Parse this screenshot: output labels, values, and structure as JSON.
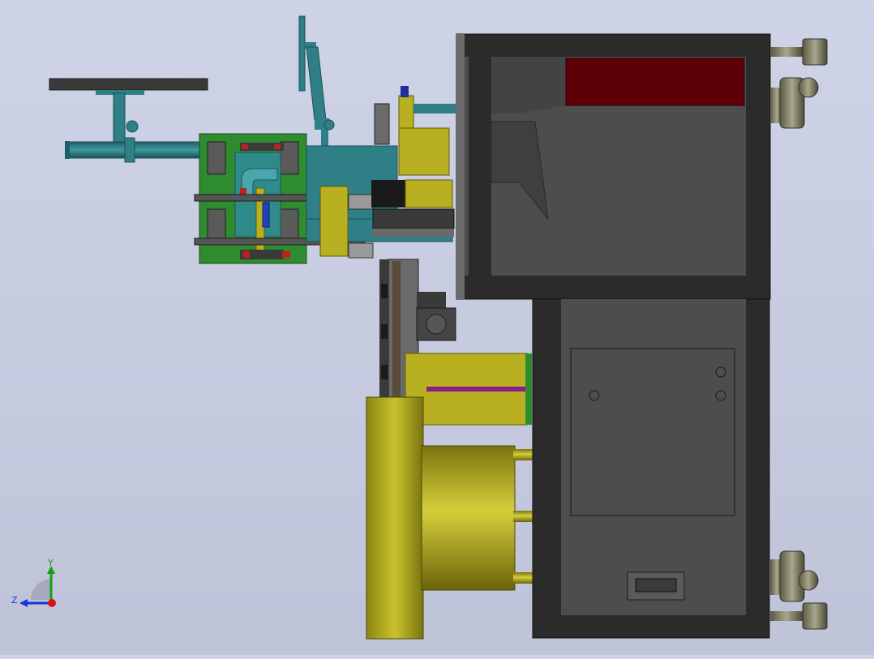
{
  "viewport": {
    "background_top": "#cfd3e6",
    "background_bottom": "#bfc3d8"
  },
  "triad": {
    "x_label": "",
    "y_label": "Y",
    "z_label": "Z",
    "x_color": "#d41414",
    "y_color": "#14a014",
    "z_color": "#1438d4"
  },
  "colors": {
    "frame_dark": "#2b2b2b",
    "frame_mid": "#4a4a4a",
    "panel_gray": "#4d4d4d",
    "teal": "#2f7f87",
    "green_plate": "#2e8b2e",
    "olive": "#b8b020",
    "dark_red": "#5e0008",
    "purple": "#8a1c8a"
  }
}
